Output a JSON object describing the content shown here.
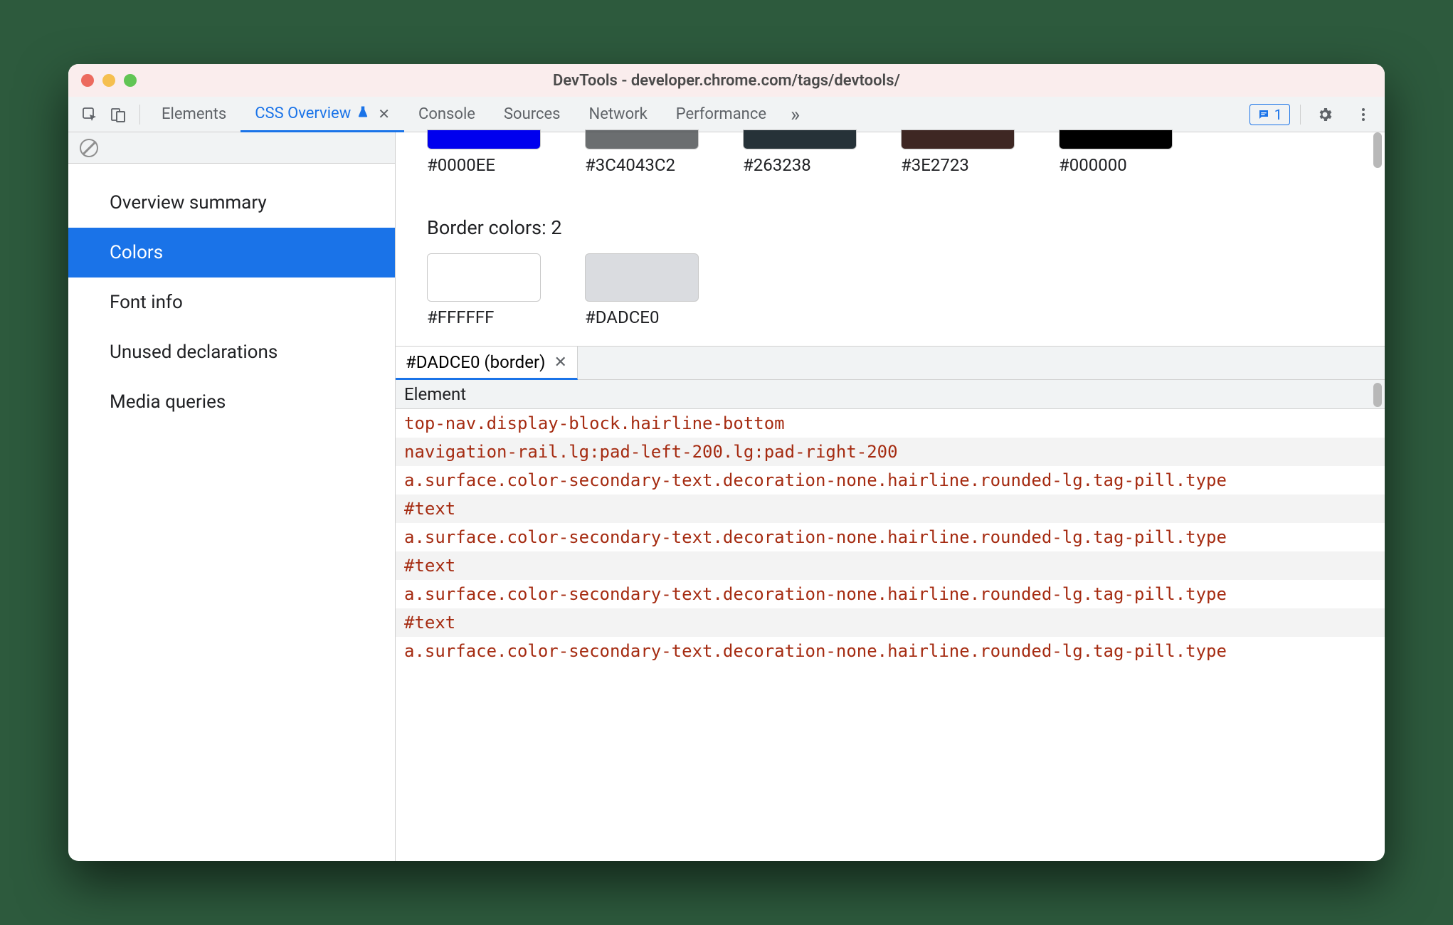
{
  "window": {
    "title": "DevTools - developer.chrome.com/tags/devtools/"
  },
  "tabs": {
    "items": [
      "Elements",
      "CSS Overview",
      "Console",
      "Sources",
      "Network",
      "Performance"
    ],
    "experiment_suffix_tab_index": 1,
    "active_index": 1
  },
  "issues": {
    "count": "1"
  },
  "sidebar": {
    "items": [
      "Overview summary",
      "Colors",
      "Font info",
      "Unused declarations",
      "Media queries"
    ],
    "active_index": 1
  },
  "swatch_row_top": [
    {
      "color": "#0000EE",
      "label": "#0000EE"
    },
    {
      "color": "rgba(60,64,67,0.76)",
      "label": "#3C4043C2"
    },
    {
      "color": "#263238",
      "label": "#263238"
    },
    {
      "color": "#3E2723",
      "label": "#3E2723"
    },
    {
      "color": "#000000",
      "label": "#000000"
    }
  ],
  "border_section": {
    "title": "Border colors: 2",
    "swatches": [
      {
        "color": "#FFFFFF",
        "label": "#FFFFFF"
      },
      {
        "color": "#DADCE0",
        "label": "#DADCE0"
      }
    ]
  },
  "details": {
    "tab_label": "#DADCE0 (border)",
    "header": "Element",
    "rows": [
      "top-nav.display-block.hairline-bottom",
      "navigation-rail.lg:pad-left-200.lg:pad-right-200",
      "a.surface.color-secondary-text.decoration-none.hairline.rounded-lg.tag-pill.type",
      "#text",
      "a.surface.color-secondary-text.decoration-none.hairline.rounded-lg.tag-pill.type",
      "#text",
      "a.surface.color-secondary-text.decoration-none.hairline.rounded-lg.tag-pill.type",
      "#text",
      "a.surface.color-secondary-text.decoration-none.hairline.rounded-lg.tag-pill.type"
    ]
  }
}
